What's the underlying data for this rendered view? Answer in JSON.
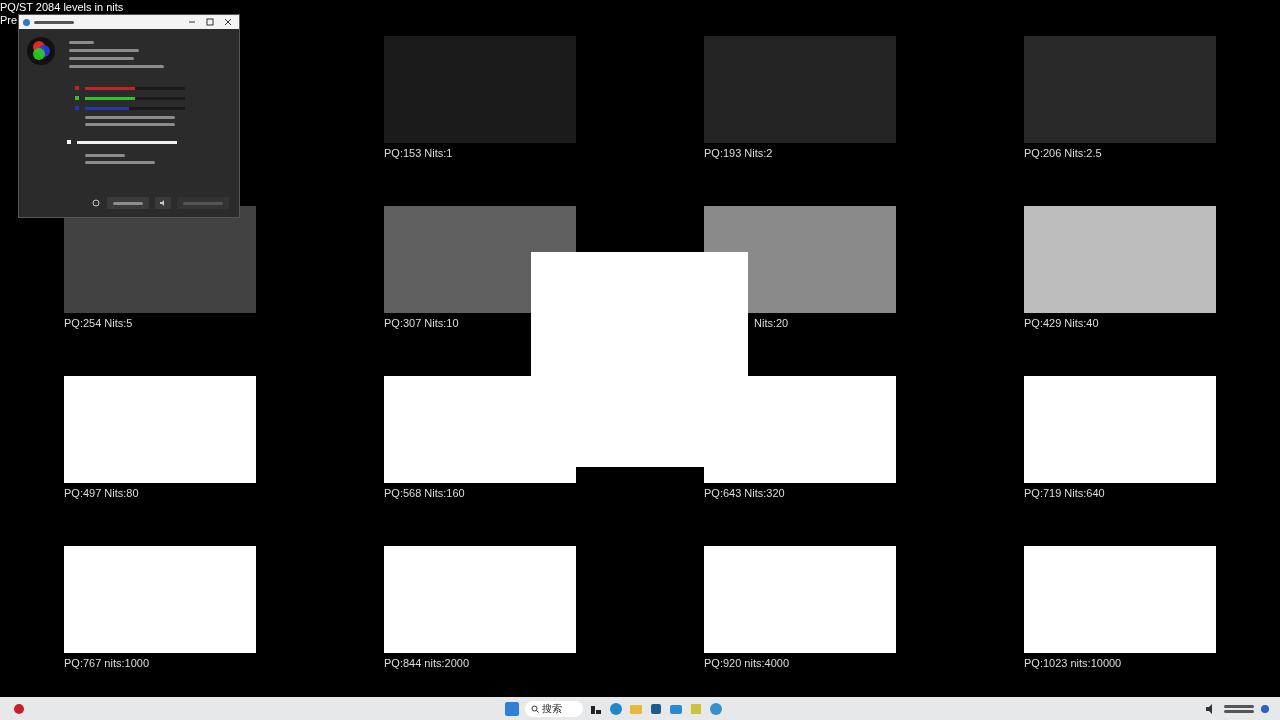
{
  "title": "PQ/ST 2084 levels in nits",
  "subtitle": "Pre",
  "patches": [
    {
      "label": "PQ:153  Nits:1",
      "color": "#1b1b1b"
    },
    {
      "label": "PQ:193  Nits:2",
      "color": "#232323"
    },
    {
      "label": "PQ:206  Nits:2.5",
      "color": "#282828"
    },
    {
      "label": "PQ:254  Nits:5",
      "color": "#424242"
    },
    {
      "label": "PQ:307  Nits:10",
      "color": "#5f5f5f"
    },
    {
      "label": "Nits:20",
      "color": "#8a8a8a"
    },
    {
      "label": "PQ:429  Nits:40",
      "color": "#bdbdbd"
    },
    {
      "label": "PQ:497  Nits:80",
      "color": "#ffffff"
    },
    {
      "label": "PQ:568  Nits:160",
      "color": "#ffffff"
    },
    {
      "label": "PQ:643  Nits:320",
      "color": "#ffffff"
    },
    {
      "label": "PQ:719  Nits:640",
      "color": "#ffffff"
    },
    {
      "label": "PQ:767  nits:1000",
      "color": "#ffffff"
    },
    {
      "label": "PQ:844  nits:2000",
      "color": "#ffffff"
    },
    {
      "label": "PQ:920  nits:4000",
      "color": "#ffffff"
    },
    {
      "label": "PQ:1023  nits:10000",
      "color": "#ffffff"
    }
  ],
  "dialog": {
    "channel_sliders": [
      {
        "color": "#c42323",
        "level": 0.5
      },
      {
        "color": "#2fc12f",
        "level": 0.5
      },
      {
        "color": "#2336b0",
        "level": 0.44
      }
    ],
    "white_slider": {
      "level": 1
    }
  },
  "taskbar": {
    "search": {
      "placeholder": "搜索"
    }
  }
}
